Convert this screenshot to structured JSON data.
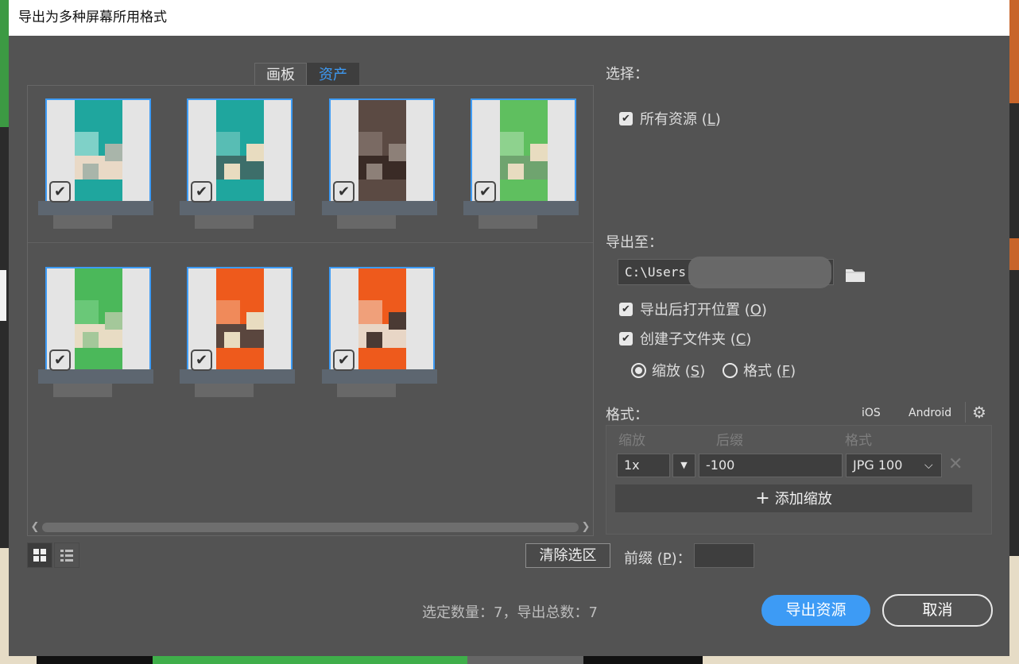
{
  "window": {
    "title": "导出为多种屏幕所用格式"
  },
  "tabs": [
    {
      "label": "画板",
      "active": false
    },
    {
      "label": "资产",
      "active": true
    }
  ],
  "assets": [
    {
      "checked": true,
      "colors": [
        "#1fa69e",
        "#7fd1c8",
        "#e9d9c6",
        "#a9b5aa"
      ]
    },
    {
      "checked": true,
      "colors": [
        "#1fa69e",
        "#58bdb4",
        "#3d6e6a",
        "#e8dcc0"
      ]
    },
    {
      "checked": true,
      "colors": [
        "#5b4a43",
        "#7a6a63",
        "#3a2b26",
        "#8d8078"
      ]
    },
    {
      "checked": true,
      "colors": [
        "#5fbf5f",
        "#8ed28e",
        "#6fa46f",
        "#e8dcc0"
      ]
    },
    {
      "checked": true,
      "colors": [
        "#4bb85a",
        "#6ac878",
        "#e8dcc4",
        "#a4c89a"
      ]
    },
    {
      "checked": true,
      "colors": [
        "#ee5a1c",
        "#f08a5a",
        "#5a463e",
        "#e8dcc0"
      ]
    },
    {
      "checked": true,
      "colors": [
        "#ee5a1c",
        "#f0a07a",
        "#e8d6c6",
        "#4a3a34"
      ]
    }
  ],
  "view_toggle": {
    "grid_icon": "grid-view-icon",
    "list_icon": "list-view-icon"
  },
  "select": {
    "heading": "选择：",
    "all_assets": {
      "label_prefix": "所有资源 (",
      "key": "L",
      "label_suffix": ")",
      "checked": true
    }
  },
  "export_to": {
    "heading": "导出至：",
    "path": "C:\\Users",
    "folder_icon": "folder-icon",
    "open_after": {
      "label_prefix": "导出后打开位置 (",
      "key": "O",
      "label_suffix": ")",
      "checked": true
    },
    "subfolders": {
      "label_prefix": "创建子文件夹 (",
      "key": "C",
      "label_suffix": ")",
      "checked": true
    },
    "by_scale": {
      "label_prefix": "缩放 (",
      "key": "S",
      "label_suffix": ")",
      "selected": true
    },
    "by_format": {
      "label_prefix": "格式 (",
      "key": "F",
      "label_suffix": ")",
      "selected": false
    }
  },
  "formats": {
    "heading": "格式：",
    "ios": "iOS",
    "android": "Android",
    "columns": {
      "scale": "缩放",
      "suffix": "后缀",
      "format": "格式"
    },
    "rows": [
      {
        "scale": "1x",
        "suffix": "-100",
        "format": "JPG 100"
      }
    ],
    "add_scale": "添加缩放"
  },
  "clear_selection": "清除选区",
  "prefix": {
    "label_prefix": "前缀 (",
    "key": "P",
    "label_suffix": ")：",
    "value": ""
  },
  "summary": "选定数量：7，导出总数：7",
  "buttons": {
    "export": "导出资源",
    "cancel": "取消"
  },
  "accent_color": "#3d9bf5"
}
